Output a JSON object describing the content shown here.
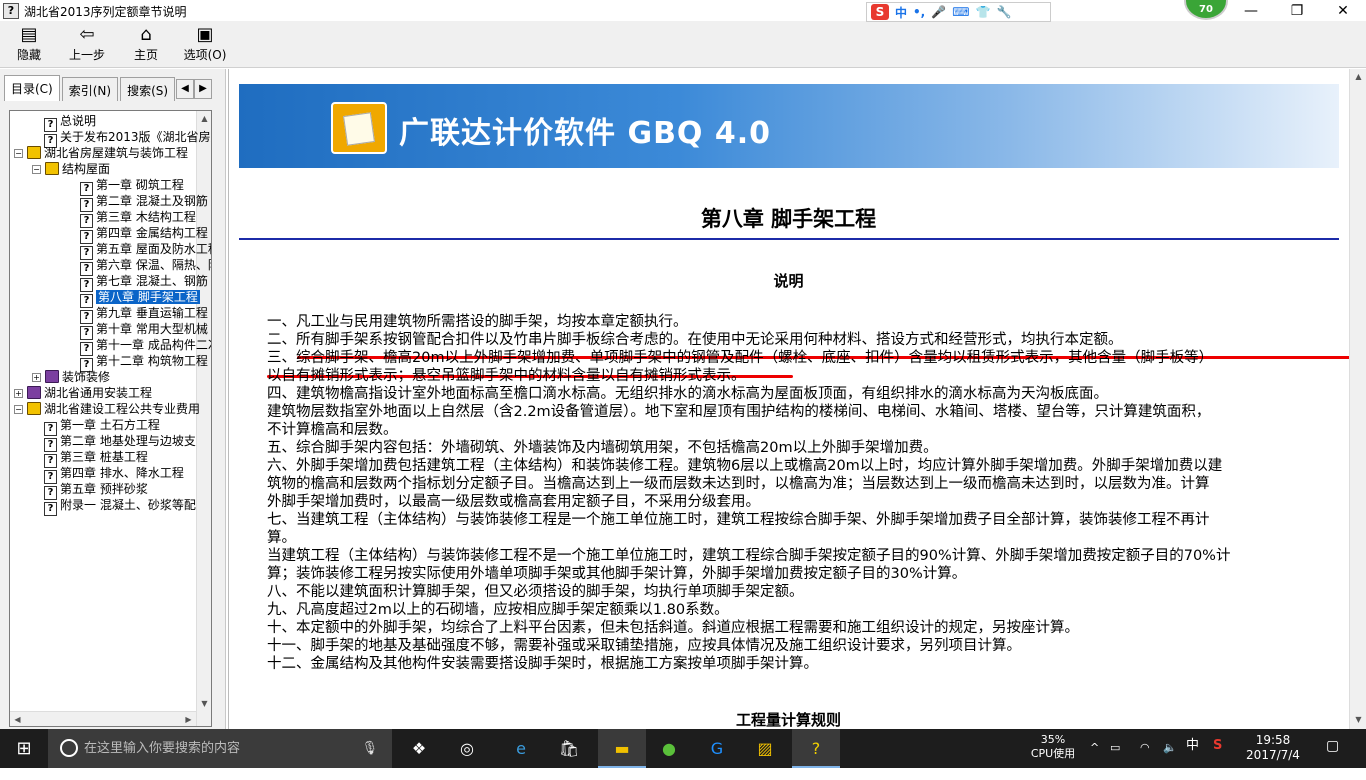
{
  "window": {
    "title": "湖北省2013序列定额章节说明",
    "minimize": "—",
    "restore": "❐",
    "close": "✕"
  },
  "ime": {
    "logo": "S",
    "lang": "中",
    "punct": "•,",
    "icons": [
      "mic-icon",
      "keyboard-icon",
      "skin-icon",
      "tools-icon"
    ]
  },
  "badge": "70",
  "toolbar": {
    "hide": "隐藏",
    "back": "上一步",
    "home": "主页",
    "options": "选项(O)"
  },
  "nav_tabs": [
    "目录(C)",
    "索引(N)",
    "搜索(S)"
  ],
  "tree": {
    "items": [
      {
        "label": "总说明",
        "level": 1,
        "icon": "q"
      },
      {
        "label": "关于发布2013版《湖北省房屋",
        "level": 1,
        "icon": "q"
      },
      {
        "label": "湖北省房屋建筑与装饰工程",
        "level": 0,
        "icon": "book",
        "expander": "−"
      },
      {
        "label": "结构屋面",
        "level": 1,
        "icon": "book",
        "expander": "−"
      },
      {
        "label": "第一章 砌筑工程",
        "level": 2,
        "icon": "q"
      },
      {
        "label": "第二章 混凝土及钢筋",
        "level": 2,
        "icon": "q"
      },
      {
        "label": "第三章 木结构工程",
        "level": 2,
        "icon": "q"
      },
      {
        "label": "第四章 金属结构工程",
        "level": 2,
        "icon": "q"
      },
      {
        "label": "第五章 屋面及防水工程",
        "level": 2,
        "icon": "q"
      },
      {
        "label": "第六章 保温、隔热、防",
        "level": 2,
        "icon": "q"
      },
      {
        "label": "第七章 混凝土、钢筋",
        "level": 2,
        "icon": "q"
      },
      {
        "label": "第八章 脚手架工程",
        "level": 2,
        "icon": "q",
        "selected": true
      },
      {
        "label": "第九章 垂直运输工程",
        "level": 2,
        "icon": "q"
      },
      {
        "label": "第十章 常用大型机械",
        "level": 2,
        "icon": "q"
      },
      {
        "label": "第十一章 成品构件二次",
        "level": 2,
        "icon": "q"
      },
      {
        "label": "第十二章 构筑物工程",
        "level": 2,
        "icon": "q"
      },
      {
        "label": "装饰装修",
        "level": 1,
        "icon": "book-purple",
        "expander": "+"
      },
      {
        "label": "湖北省通用安装工程",
        "level": 0,
        "icon": "book-purple",
        "expander": "+"
      },
      {
        "label": "湖北省建设工程公共专业费用",
        "level": 0,
        "icon": "book",
        "expander": "−"
      },
      {
        "label": "第一章 土石方工程",
        "level": 1,
        "icon": "q"
      },
      {
        "label": "第二章 地基处理与边坡支",
        "level": 1,
        "icon": "q"
      },
      {
        "label": "第三章 桩基工程",
        "level": 1,
        "icon": "q"
      },
      {
        "label": "第四章 排水、降水工程",
        "level": 1,
        "icon": "q"
      },
      {
        "label": "第五章 预拌砂浆",
        "level": 1,
        "icon": "q"
      },
      {
        "label": "附录一 混凝土、砂浆等配",
        "level": 1,
        "icon": "q"
      }
    ]
  },
  "banner": {
    "title": "广联达计价软件 GBQ 4.0"
  },
  "doc": {
    "chapter_title": "第八章 脚手架工程",
    "section_title": "说明",
    "paragraphs": [
      "一、凡工业与民用建筑物所需搭设的脚手架，均按本章定额执行。",
      "二、所有脚手架系按钢管配合扣件以及竹串片脚手板综合考虑的。在使用中无论采用何种材料、搭设方式和经营形式，均执行本定额。",
      "三、综合脚手架、檐高20m以上外脚手架增加费、单项脚手架中的钢管及配件（螺栓、底座、扣件）含量均以租赁形式表示，其他含量（脚手板等）",
      "以自有摊销形式表示；悬空吊篮脚手架中的材料含量以自有摊销形式表示。",
      "四、建筑物檐高指设计室外地面标高至檐口滴水标高。无组织排水的滴水标高为屋面板顶面，有组织排水的滴水标高为天沟板底面。",
      "建筑物层数指室外地面以上自然层（含2.2m设备管道层）。地下室和屋顶有围护结构的楼梯间、电梯间、水箱间、塔楼、望台等，只计算建筑面积，",
      "不计算檐高和层数。",
      "五、综合脚手架内容包括：外墙砌筑、外墙装饰及内墙砌筑用架，不包括檐高20m以上外脚手架增加费。",
      "六、外脚手架增加费包括建筑工程（主体结构）和装饰装修工程。建筑物6层以上或檐高20m以上时，均应计算外脚手架增加费。外脚手架增加费以建",
      "筑物的檐高和层数两个指标划分定额子目。当檐高达到上一级而层数未达到时，以檐高为准；当层数达到上一级而檐高未达到时，以层数为准。计算",
      "外脚手架增加费时，以最高一级层数或檐高套用定额子目，不采用分级套用。",
      "七、当建筑工程（主体结构）与装饰装修工程是一个施工单位施工时，建筑工程按综合脚手架、外脚手架增加费子目全部计算，装饰装修工程不再计",
      "算。",
      "当建筑工程（主体结构）与装饰装修工程不是一个施工单位施工时，建筑工程综合脚手架按定额子目的90%计算、外脚手架增加费按定额子目的70%计",
      "算；装饰装修工程另按实际使用外墙单项脚手架或其他脚手架计算，外脚手架增加费按定额子目的30%计算。",
      "八、不能以建筑面积计算脚手架，但又必须搭设的脚手架，均执行单项脚手架定额。",
      "九、凡高度超过2m以上的石砌墙，应按相应脚手架定额乘以1.80系数。",
      "十、本定额中的外脚手架，均综合了上料平台因素，但未包括斜道。斜道应根据工程需要和施工组织设计的规定，另按座计算。",
      "十一、脚手架的地基及基础强度不够，需要补强或采取铺垫措施，应按具体情况及施工组织设计要求，另列项目计算。",
      "十二、金属结构及其他构件安装需要搭设脚手架时，根据施工方案按单项脚手架计算。"
    ],
    "bottom_title": "工程量计算规则"
  },
  "taskbar": {
    "search_placeholder": "在这里输入你要搜索的内容",
    "cpu_percent": "35%",
    "cpu_label": "CPU使用",
    "ime_lang": "中",
    "time": "19:58",
    "date": "2017/7/4"
  }
}
